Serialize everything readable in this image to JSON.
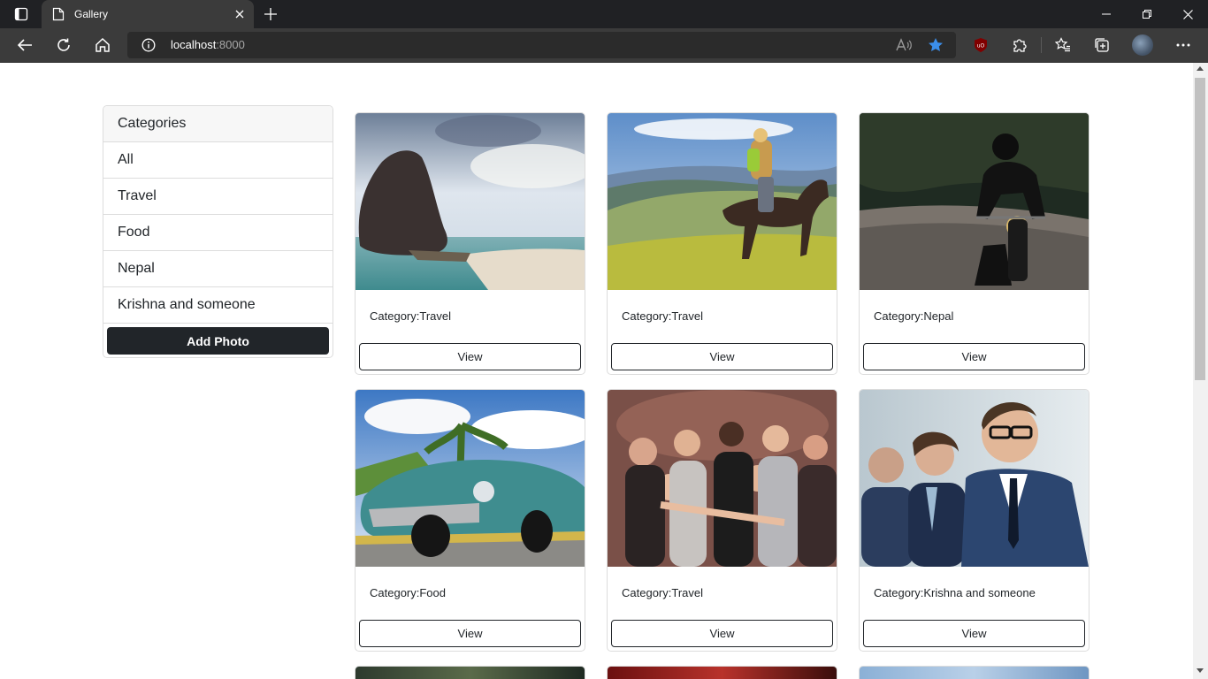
{
  "browser": {
    "tab_title": "Gallery",
    "url_host": "localhost",
    "url_port": ":8000"
  },
  "sidebar": {
    "header": "Categories",
    "items": [
      "All",
      "Travel",
      "Food",
      "Nepal",
      "Krishna and someone"
    ],
    "add_button": "Add Photo"
  },
  "photos": [
    {
      "category_label": "Category:Travel",
      "view_label": "View",
      "image": "sea-rock-beach"
    },
    {
      "category_label": "Category:Travel",
      "view_label": "View",
      "image": "horse-rider-hills"
    },
    {
      "category_label": "Category:Nepal",
      "view_label": "View",
      "image": "motorcycle-rider-road"
    },
    {
      "category_label": "Category:Food",
      "view_label": "View",
      "image": "vintage-car-palm"
    },
    {
      "category_label": "Category:Travel",
      "view_label": "View",
      "image": "party-crowd"
    },
    {
      "category_label": "Category:Krishna and someone",
      "view_label": "View",
      "image": "business-people"
    }
  ],
  "colors": {
    "accent_star": "#3b8eea",
    "button_dark": "#212529",
    "chrome_dark": "#202124"
  }
}
